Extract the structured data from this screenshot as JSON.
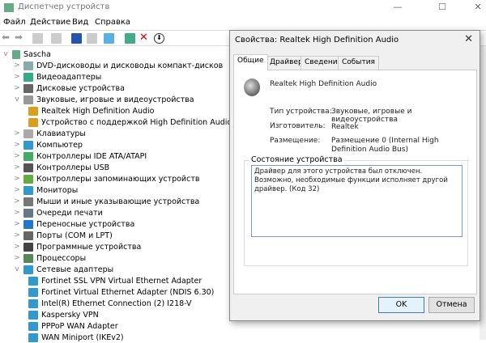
{
  "window": {
    "title": "Диспетчер устройств",
    "minimize": "—",
    "maximize": "☐",
    "close": "✕"
  },
  "menu": [
    "Файл",
    "Действие",
    "Вид",
    "Справка"
  ],
  "tree": {
    "root": "Sascha",
    "items": [
      {
        "label": "DVD-дисководы и дисководы компакт-дисков",
        "level": 1,
        "expander": ">",
        "color": "#8aa"
      },
      {
        "label": "Видеоадаптеры",
        "level": 1,
        "expander": ">",
        "color": "#3a8"
      },
      {
        "label": "Дисковые устройства",
        "level": 1,
        "expander": ">",
        "color": "#666"
      },
      {
        "label": "Звуковые, игровые и видеоустройства",
        "level": 1,
        "expander": "v",
        "color": "#999"
      },
      {
        "label": "Realtek High Definition Audio",
        "level": 2,
        "expander": "",
        "color": "#d9a020"
      },
      {
        "label": "Устройство с поддержкой High Definition Audio",
        "level": 2,
        "expander": "",
        "color": "#d9a020"
      },
      {
        "label": "Клавиатуры",
        "level": 1,
        "expander": ">",
        "color": "#aaa"
      },
      {
        "label": "Компьютер",
        "level": 1,
        "expander": ">",
        "color": "#39c"
      },
      {
        "label": "Контроллеры IDE ATA/ATAPI",
        "level": 1,
        "expander": ">",
        "color": "#4a6"
      },
      {
        "label": "Контроллеры USB",
        "level": 1,
        "expander": ">",
        "color": "#555"
      },
      {
        "label": "Контроллеры запоминающих устройств",
        "level": 1,
        "expander": ">",
        "color": "#6a4"
      },
      {
        "label": "Мониторы",
        "level": 1,
        "expander": ">",
        "color": "#39c"
      },
      {
        "label": "Мыши и иные указывающие устройства",
        "level": 1,
        "expander": ">",
        "color": "#777"
      },
      {
        "label": "Очереди печати",
        "level": 1,
        "expander": ">",
        "color": "#678"
      },
      {
        "label": "Переносные устройства",
        "level": 1,
        "expander": ">",
        "color": "#27c"
      },
      {
        "label": "Порты (COM и LPT)",
        "level": 1,
        "expander": ">",
        "color": "#666"
      },
      {
        "label": "Программные устройства",
        "level": 1,
        "expander": ">",
        "color": "#444"
      },
      {
        "label": "Процессоры",
        "level": 1,
        "expander": ">",
        "color": "#585"
      },
      {
        "label": "Сетевые адаптеры",
        "level": 1,
        "expander": "v",
        "color": "#39c"
      },
      {
        "label": "Fortinet SSL VPN Virtual Ethernet Adapter",
        "level": 2,
        "expander": "",
        "color": "#39c"
      },
      {
        "label": "Fortinet Virtual Ethernet Adapter (NDIS 6.30)",
        "level": 2,
        "expander": "",
        "color": "#39c"
      },
      {
        "label": "Intel(R) Ethernet Connection (2) I218-V",
        "level": 2,
        "expander": "",
        "color": "#39c"
      },
      {
        "label": "Kaspersky VPN",
        "level": 2,
        "expander": "",
        "color": "#39c"
      },
      {
        "label": "PPPoP WAN Adapter",
        "level": 2,
        "expander": "",
        "color": "#39c"
      },
      {
        "label": "WAN Miniport (IKEv2)",
        "level": 2,
        "expander": "",
        "color": "#39c"
      }
    ]
  },
  "dialog": {
    "title": "Свойства: Realtek High Definition Audio",
    "close": "✕",
    "tabs": [
      "Общие",
      "Драйвер",
      "Сведения",
      "События"
    ],
    "device_name": "Realtek High Definition Audio",
    "type_label": "Тип устройства:",
    "type_value": "Звуковые, игровые и видеоустройства",
    "maker_label": "Изготовитель:",
    "maker_value": "Realtek",
    "location_label": "Размещение:",
    "location_value": "Размещение 0 (Internal High Definition Audio Bus)",
    "status_group": "Состояние устройства",
    "status_text": "Драйвер для этого устройства был отключен. Возможно, необходимые функции исполняет другой драйвер. (Код 32)",
    "ok": "OK",
    "cancel": "Отмена"
  }
}
